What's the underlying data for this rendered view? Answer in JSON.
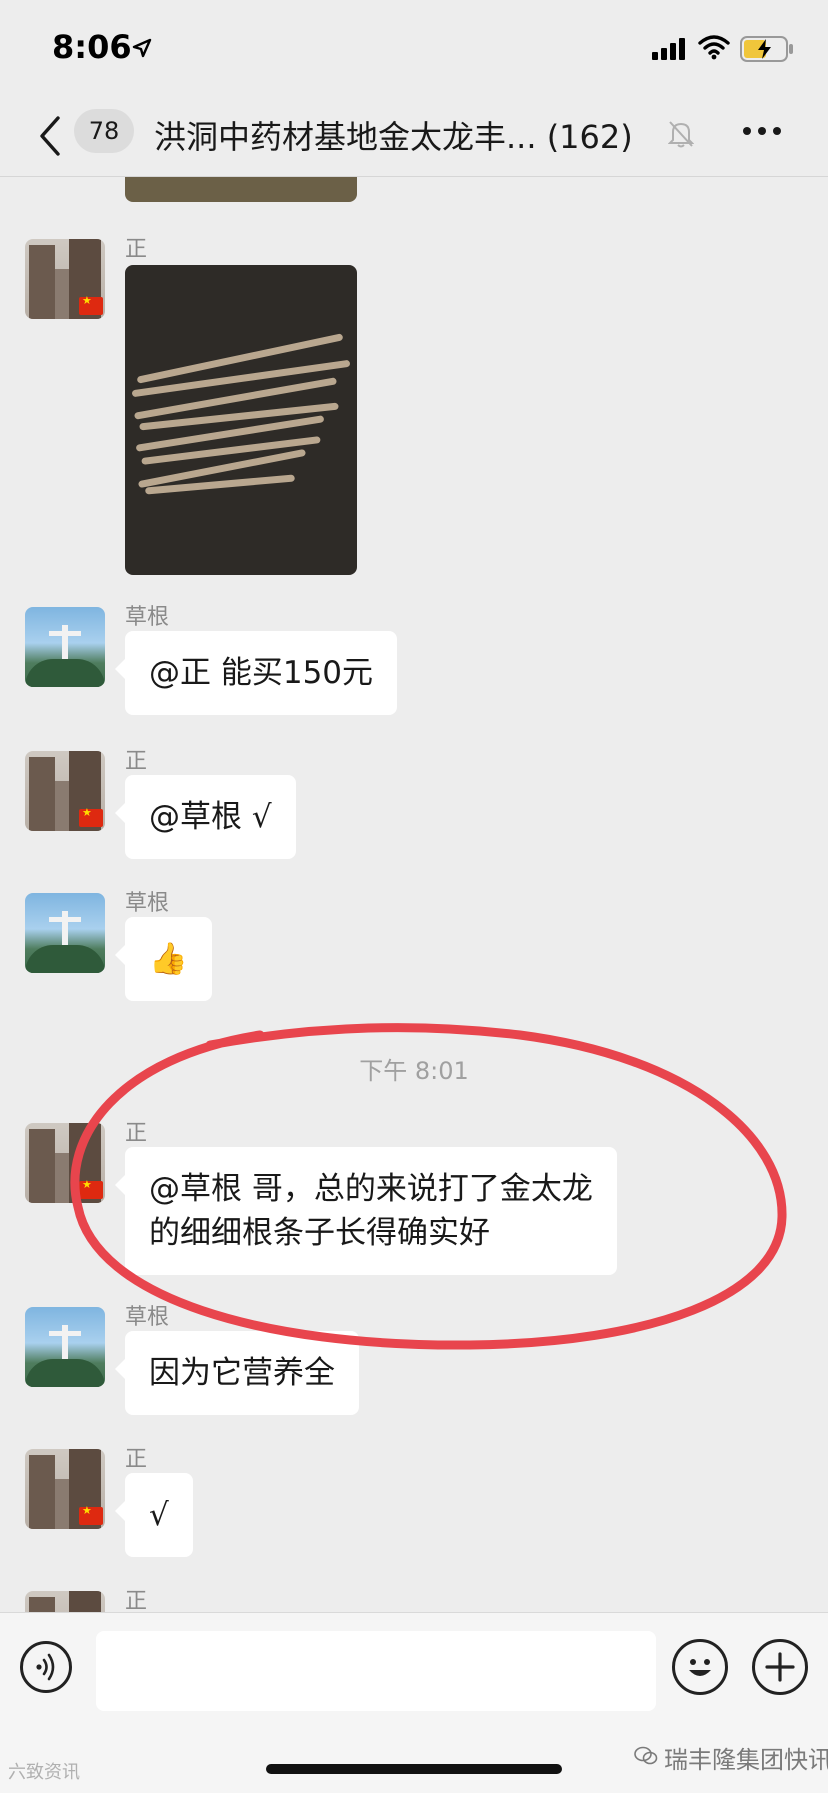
{
  "status_bar": {
    "time": "8:06"
  },
  "nav": {
    "unread_count": "78",
    "title": "洪洞中药材基地金太龙丰... (162)"
  },
  "messages": [
    {
      "sender": "正",
      "type": "image",
      "description": "roots"
    },
    {
      "sender": "草根",
      "type": "text",
      "text": "@正 能买150元"
    },
    {
      "sender": "正",
      "type": "text",
      "text": "@草根 √"
    },
    {
      "sender": "草根",
      "type": "emoji",
      "text": "👍"
    },
    {
      "type": "timestamp",
      "text": "下午 8:01"
    },
    {
      "sender": "正",
      "type": "text",
      "line1": "@草根 哥，总的来说打了金太龙",
      "line2": "的细细根条子长得确实好"
    },
    {
      "sender": "草根",
      "type": "text",
      "text": "因为它营养全"
    },
    {
      "sender": "正",
      "type": "text",
      "text": "√"
    },
    {
      "sender": "正",
      "type": "partial"
    }
  ],
  "watermarks": {
    "left": "六致资讯",
    "right": "瑞丰隆集团快讯"
  },
  "colors": {
    "annotation": "#e8454d",
    "bubble": "#ffffff",
    "background": "#ededed"
  }
}
